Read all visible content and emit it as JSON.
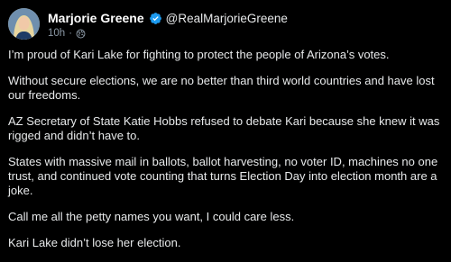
{
  "post": {
    "author_name": "Marjorie Greene",
    "handle": "@RealMarjorieGreene",
    "time": "10h",
    "separator": "·",
    "icons": {
      "verified": "verified-badge-icon",
      "audience": "globe-icon"
    },
    "colors": {
      "verified": "#1d9bf0",
      "background": "#000000",
      "text": "#e7e9ea",
      "muted": "#8b98a5"
    },
    "paragraphs": [
      "I’m proud of Kari Lake for fighting to protect the people of Arizona’s votes.",
      "Without secure elections, we are no better than third world countries and have lost our freedoms.",
      "AZ Secretary of State Katie Hobbs refused to debate Kari because she knew it was rigged and didn’t have to.",
      "States with massive mail in ballots, ballot harvesting, no voter ID, machines no one trust, and continued vote counting that turns Election Day into election month are a joke.",
      "Call me all the petty names you want, I could care less.",
      "Kari Lake didn’t lose her election."
    ]
  }
}
